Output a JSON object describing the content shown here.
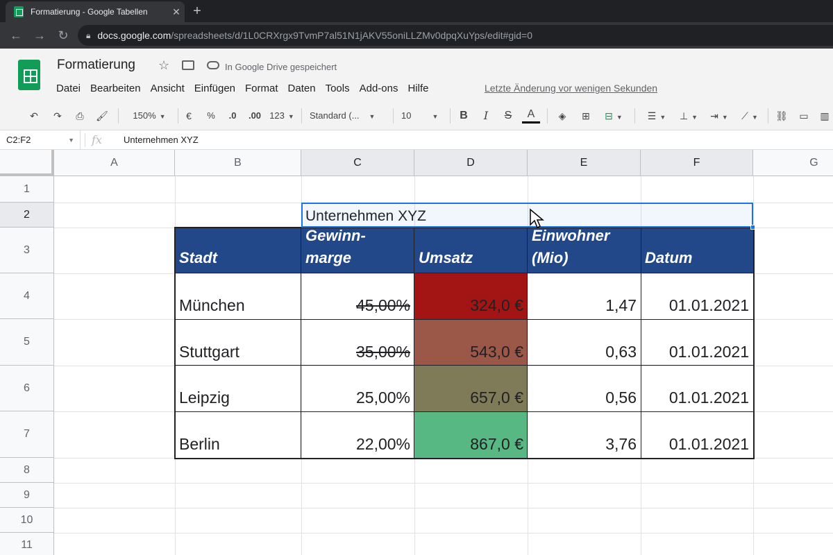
{
  "browser": {
    "tab_title": "Formatierung - Google Tabellen",
    "tab_close": "✕",
    "new_tab": "+",
    "url_host": "docs.google.com",
    "url_path": "/spreadsheets/d/1L0CRXrgx9TvmP7al51N1jAKV55oniLLZMv0dpqXuYps/edit#gid=0"
  },
  "app": {
    "doc_title": "Formatierung",
    "drive_status": "In Google Drive gespeichert",
    "menu": [
      "Datei",
      "Bearbeiten",
      "Ansicht",
      "Einfügen",
      "Format",
      "Daten",
      "Tools",
      "Add-ons",
      "Hilfe"
    ],
    "last_edit": "Letzte Änderung vor wenigen Sekunden"
  },
  "toolbar": {
    "zoom": "150%",
    "currency": "€",
    "percent": "%",
    "decrease_decimals": ".0",
    "increase_decimals": ".00",
    "more_formats": "123",
    "font": "Standard (...",
    "font_size": "10",
    "bold": "B",
    "italic": "I",
    "strikethrough": "S",
    "text_color": "A"
  },
  "formula_bar": {
    "name_box": "C2:F2",
    "fx": "fx",
    "value": "Unternehmen XYZ"
  },
  "grid": {
    "columns": [
      "A",
      "B",
      "C",
      "D",
      "E",
      "F",
      "G"
    ],
    "rows": [
      "1",
      "2",
      "3",
      "4",
      "5",
      "6",
      "7",
      "8",
      "9",
      "10",
      "11"
    ],
    "title_cell": "Unternehmen XYZ",
    "headers": {
      "stadt": "Stadt",
      "gewinnmarge_1": "Gewinn-",
      "gewinnmarge_2": "marge",
      "umsatz": "Umsatz",
      "einwohner_1": "Einwohner",
      "einwohner_2": "(Mio)",
      "datum": "Datum"
    },
    "data_rows": [
      {
        "stadt": "München",
        "marge": "45,00%",
        "umsatz": "324,0 €",
        "einwohner": "1,47",
        "datum": "01.01.2021"
      },
      {
        "stadt": "Stuttgart",
        "marge": "35,00%",
        "umsatz": "543,0 €",
        "einwohner": "0,63",
        "datum": "01.01.2021"
      },
      {
        "stadt": "Leipzig",
        "marge": "25,00%",
        "umsatz": "657,0 €",
        "einwohner": "0,56",
        "datum": "01.01.2021"
      },
      {
        "stadt": "Berlin",
        "marge": "22,00%",
        "umsatz": "867,0 €",
        "einwohner": "3,76",
        "datum": "01.01.2021"
      }
    ]
  },
  "colors": {
    "header_fill": "#22488a",
    "umsatz_fills": [
      "#a31515",
      "#9b5747",
      "#7f7b58",
      "#57b883"
    ],
    "selection": "#1a73e8"
  }
}
